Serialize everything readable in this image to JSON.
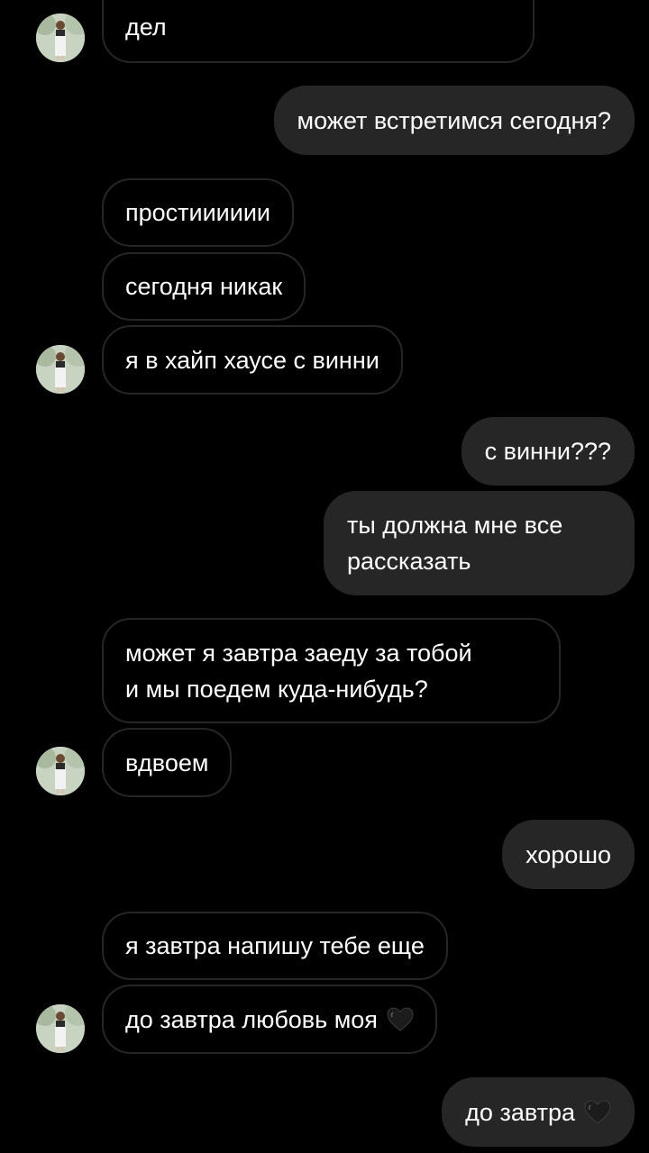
{
  "messages": [
    {
      "id": "m1",
      "side": "in",
      "text": "дел"
    },
    {
      "id": "m2",
      "side": "out",
      "text": "может встретимся сегодня?"
    },
    {
      "id": "m3",
      "side": "in",
      "text": "простииииии"
    },
    {
      "id": "m4",
      "side": "in",
      "text": "сегодня никак"
    },
    {
      "id": "m5",
      "side": "in",
      "text": "я в хайп хаусе с винни"
    },
    {
      "id": "m6",
      "side": "out",
      "text": "с винни???"
    },
    {
      "id": "m7",
      "side": "out",
      "lines": [
        "ты должна мне все",
        "рассказать"
      ]
    },
    {
      "id": "m8",
      "side": "in",
      "lines": [
        "может я завтра заеду за тобой",
        "и мы поедем куда-нибудь?"
      ]
    },
    {
      "id": "m9",
      "side": "in",
      "text": "вдвоем"
    },
    {
      "id": "m10",
      "side": "out",
      "text": "хорошо"
    },
    {
      "id": "m11",
      "side": "in",
      "text": "я завтра напишу тебе еще"
    },
    {
      "id": "m12",
      "side": "in",
      "text": "до завтра любовь моя",
      "emoji": "black-heart-icon"
    },
    {
      "id": "m13",
      "side": "out",
      "text": "до завтра",
      "emoji": "black-heart-icon"
    }
  ],
  "colors": {
    "background": "#000000",
    "outgoing_bubble": "#262626",
    "incoming_border": "#262626",
    "text": "#ffffff"
  }
}
